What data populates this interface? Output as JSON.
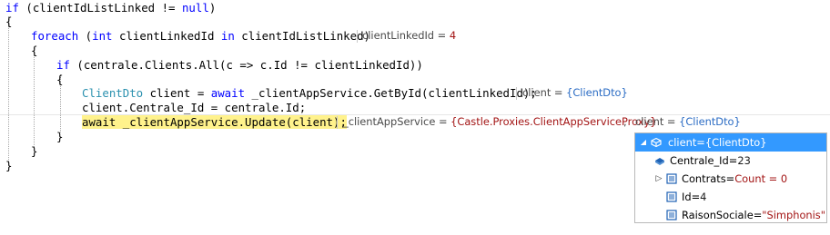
{
  "code": {
    "l1": {
      "kw_if": "if",
      "rest1": " (clientIdListLinked != ",
      "kw_null": "null",
      "rest2": ")"
    },
    "l2": {
      "text": "{"
    },
    "l3": {
      "kw_foreach": "foreach",
      "p1": " (",
      "kw_int": "int",
      "p2": " clientLinkedId ",
      "kw_in": "in",
      "p3": " clientIdListLinked)"
    },
    "l4": {
      "text": "{"
    },
    "l5": {
      "kw_if": "if",
      "rest": " (centrale.Clients.All(c => c.Id != clientLinkedId))"
    },
    "l6": {
      "text": "{"
    },
    "l7": {
      "type": "ClientDto",
      "rest1": " client = ",
      "kw_await": "await",
      "rest2": " _clientAppService.GetById(clientLinkedId);"
    },
    "l8": {
      "text": "client.Centrale_Id = centrale.Id;"
    },
    "l9": {
      "hl_text": "await _clientAppService.Update(client);"
    },
    "l10": {
      "text": "}"
    },
    "l11": {
      "text": "}"
    },
    "l12": {
      "text": "}"
    }
  },
  "inline_values": {
    "client_linked_id": {
      "name": "clientLinkedId = ",
      "value": "4"
    },
    "client_get": {
      "name": "client = ",
      "value": "{ClientDto}"
    },
    "app_service": {
      "name": "_clientAppService = ",
      "value": "{Castle.Proxies.ClientAppServiceProxy}"
    },
    "client_update": {
      "name": "client = ",
      "value": "{ClientDto}"
    }
  },
  "datatip": {
    "header": {
      "expander": "◢",
      "icon": "object-icon",
      "label": "client={ClientDto}"
    },
    "rows": [
      {
        "name": "Centrale_Id",
        "eq": "=",
        "value": "23",
        "value_color": "#1a1a1a",
        "icon": "property-icon",
        "expander": ""
      },
      {
        "name": "Contrats",
        "eq": "=",
        "value": "Count = 0",
        "value_color": "#a31515",
        "icon": "property-icon",
        "expander": "▷"
      },
      {
        "name": "Id",
        "eq": "=",
        "value": "4",
        "value_color": "#1a1a1a",
        "icon": "property-icon",
        "expander": ""
      },
      {
        "name": "RaisonSociale",
        "eq": "=",
        "value": "\"Simphonis\"",
        "value_color": "#a31515",
        "icon": "property-icon",
        "expander": ""
      }
    ]
  },
  "colors": {
    "keyword": "#0000ff",
    "type": "#2b91af",
    "highlight": "#fff28c",
    "selection": "#3399ff",
    "string": "#a31515"
  }
}
